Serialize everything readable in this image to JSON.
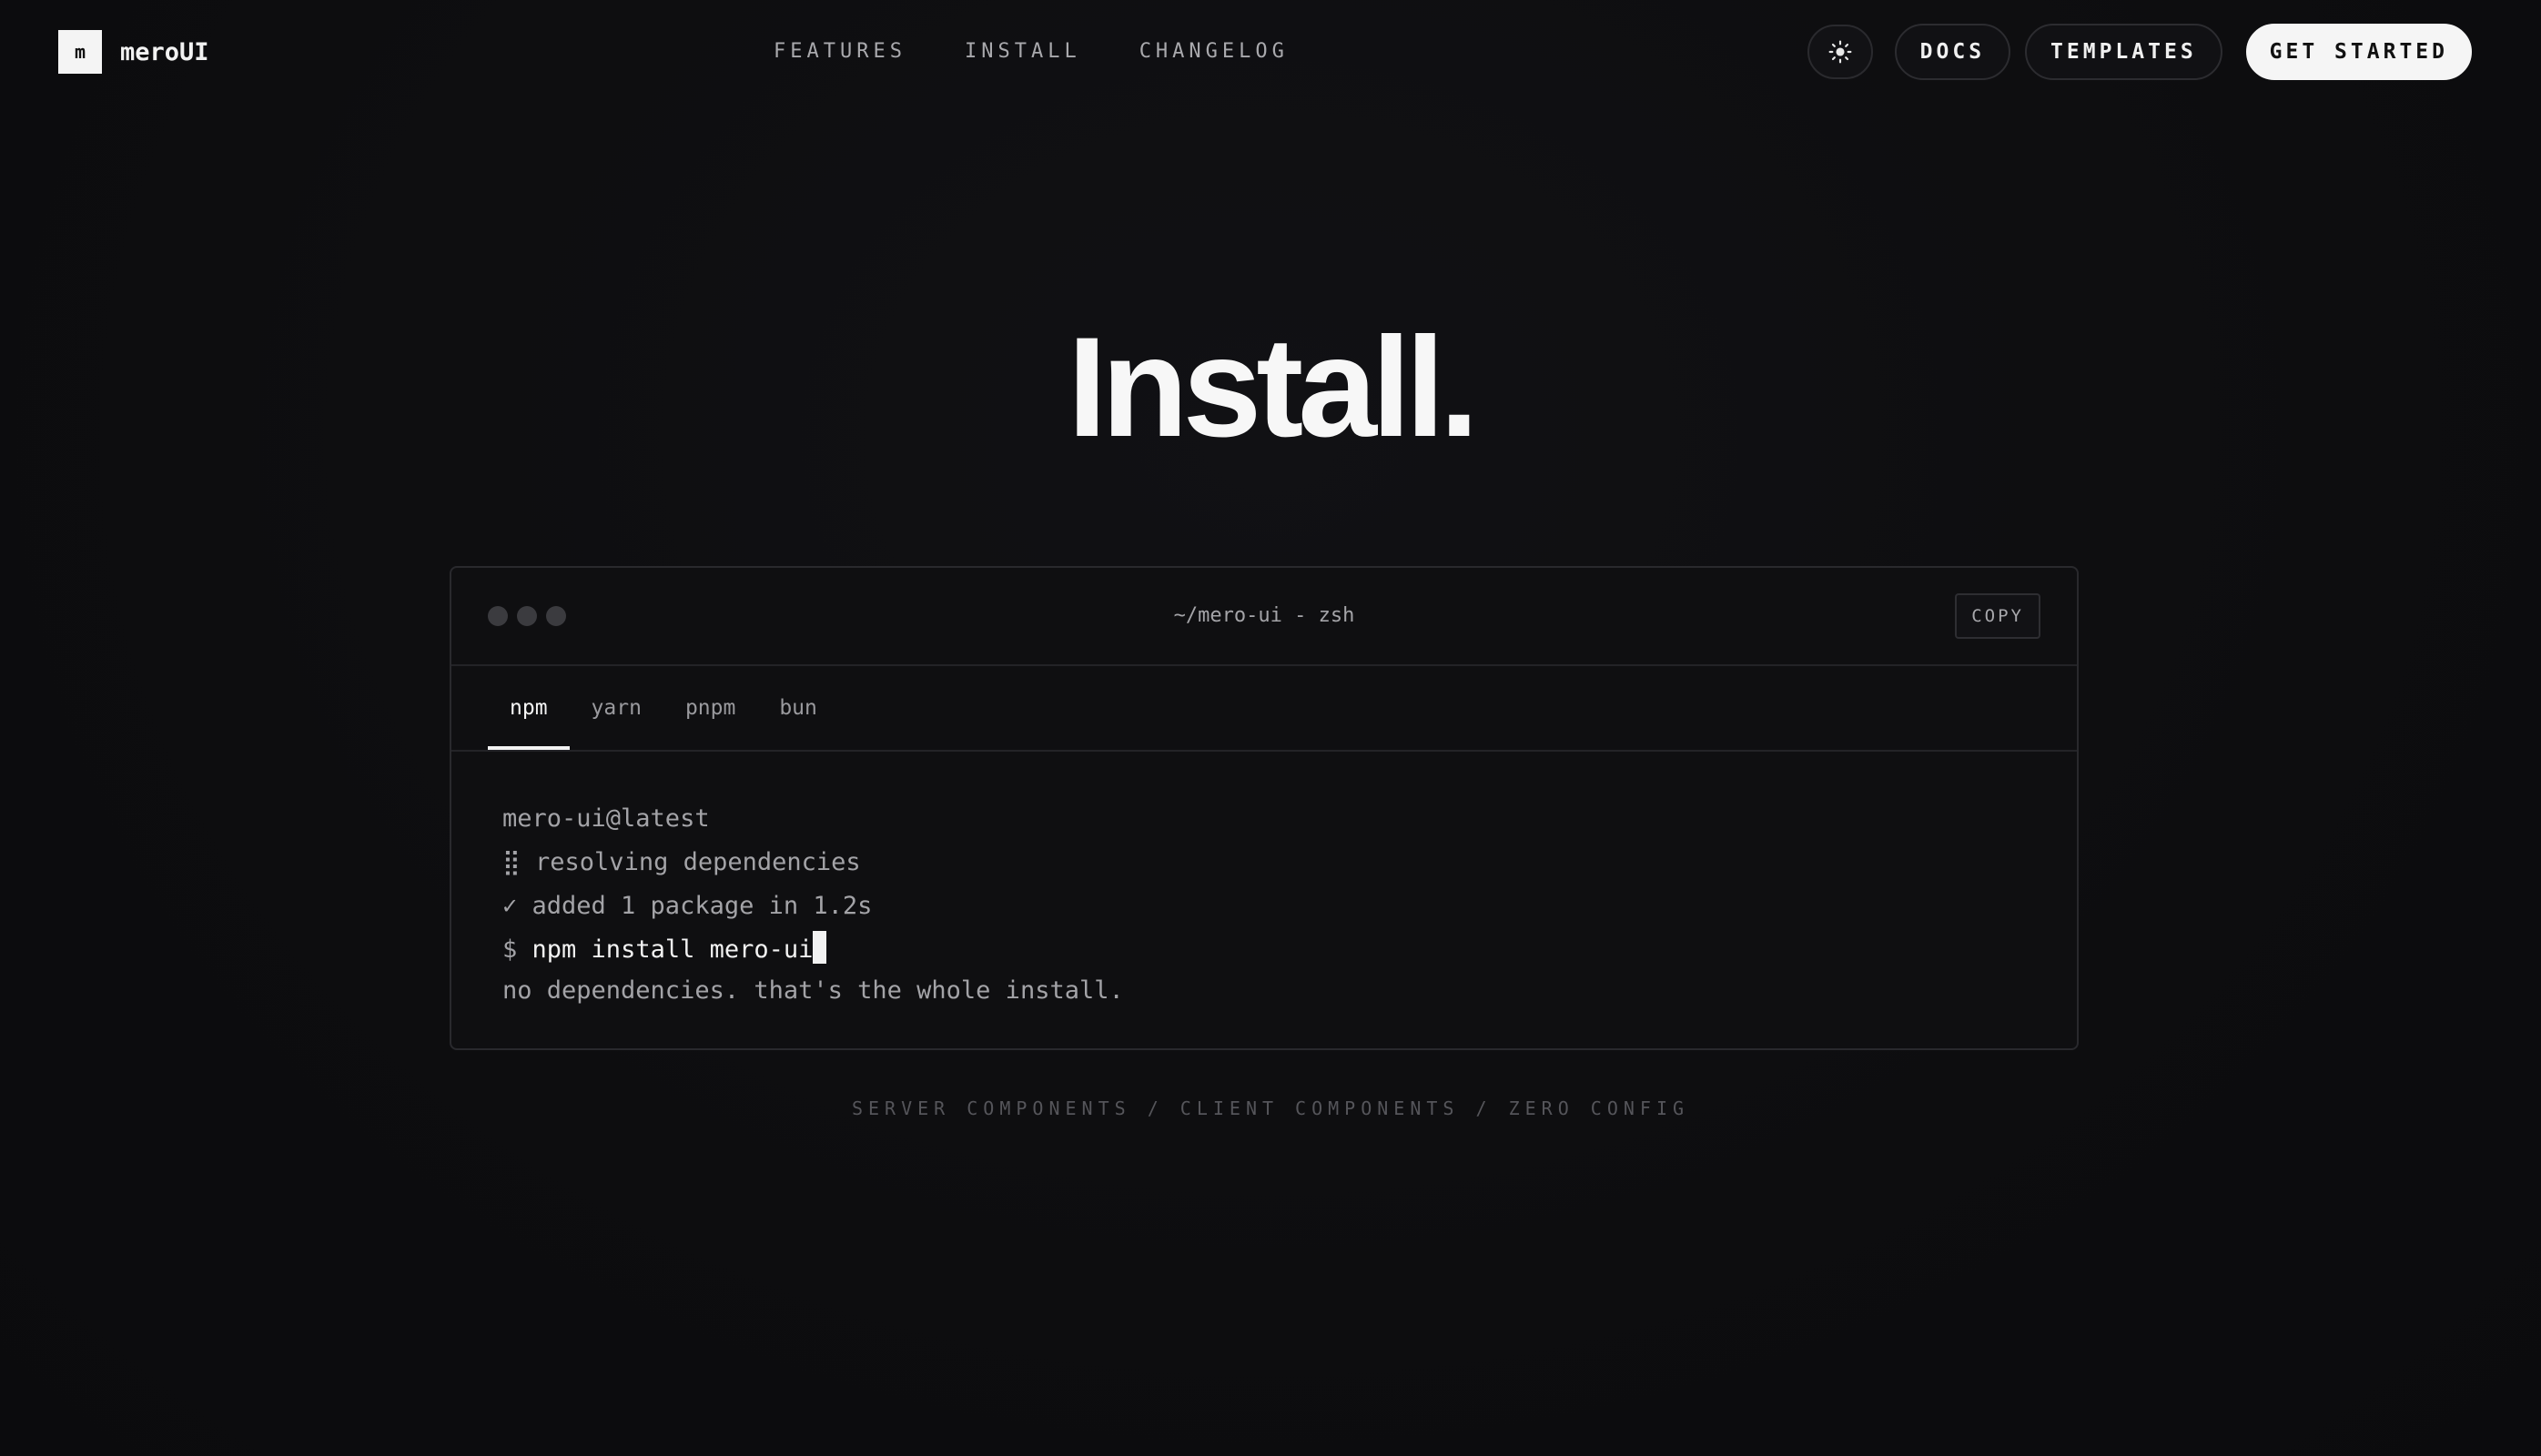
{
  "nav": {
    "brand_mark": "m",
    "brand_name": "meroUI",
    "links": [
      "FEATURES",
      "INSTALL",
      "CHANGELOG"
    ],
    "theme_toggle_icon": "sun-icon",
    "docs_label": "DOCS",
    "templates_label": "TEMPLATES",
    "cta_label": "GET STARTED"
  },
  "hero": {
    "title": "Install."
  },
  "terminal": {
    "title": "~/mero-ui - zsh",
    "copy_label": "COPY",
    "tabs": [
      "npm",
      "yarn",
      "pnpm",
      "bun"
    ],
    "active_tab": "npm",
    "lines": [
      "mero-ui@latest",
      "⣿ resolving dependencies",
      "✓ added 1 package in 1.2s"
    ],
    "prompt": "$",
    "command": "npm install mero-ui",
    "note": "no dependencies. that's the whole install."
  },
  "tagline": "SERVER COMPONENTS / CLIENT COMPONENTS / ZERO CONFIG",
  "colors": {
    "background": "#0e0e10",
    "foreground": "#f5f5f5",
    "muted": "#a3a3a7",
    "border": "#29292d"
  }
}
